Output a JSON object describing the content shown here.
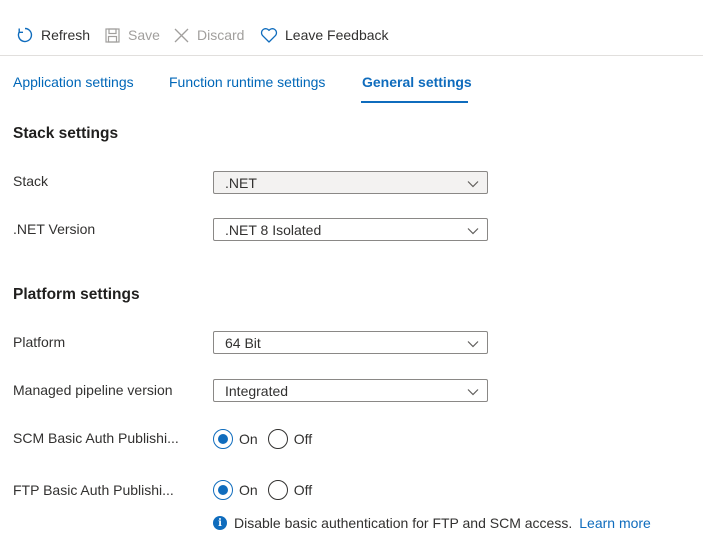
{
  "toolbar": {
    "refresh_label": "Refresh",
    "save_label": "Save",
    "discard_label": "Discard",
    "feedback_label": "Leave Feedback"
  },
  "tabs": [
    {
      "label": "Application settings",
      "active": false
    },
    {
      "label": "Function runtime settings",
      "active": false
    },
    {
      "label": "General settings",
      "active": true
    }
  ],
  "stack_settings": {
    "title": "Stack settings",
    "stack": {
      "label": "Stack",
      "value": ".NET"
    },
    "net_version": {
      "label": ".NET Version",
      "value": ".NET 8 Isolated"
    }
  },
  "platform_settings": {
    "title": "Platform settings",
    "platform": {
      "label": "Platform",
      "value": "64 Bit"
    },
    "pipeline": {
      "label": "Managed pipeline version",
      "value": "Integrated"
    },
    "scm_auth": {
      "label": "SCM Basic Auth Publishi...",
      "on_label": "On",
      "off_label": "Off",
      "selected": "On"
    },
    "ftp_auth": {
      "label": "FTP Basic Auth Publishi...",
      "on_label": "On",
      "off_label": "Off",
      "selected": "On"
    },
    "info": {
      "icon": "info-icon",
      "text": "Disable basic authentication for FTP and SCM access.",
      "link": "Learn more"
    }
  },
  "colors": {
    "accent": "#0f6cbd",
    "link": "#0067b8",
    "disabled": "#a19f9d"
  }
}
